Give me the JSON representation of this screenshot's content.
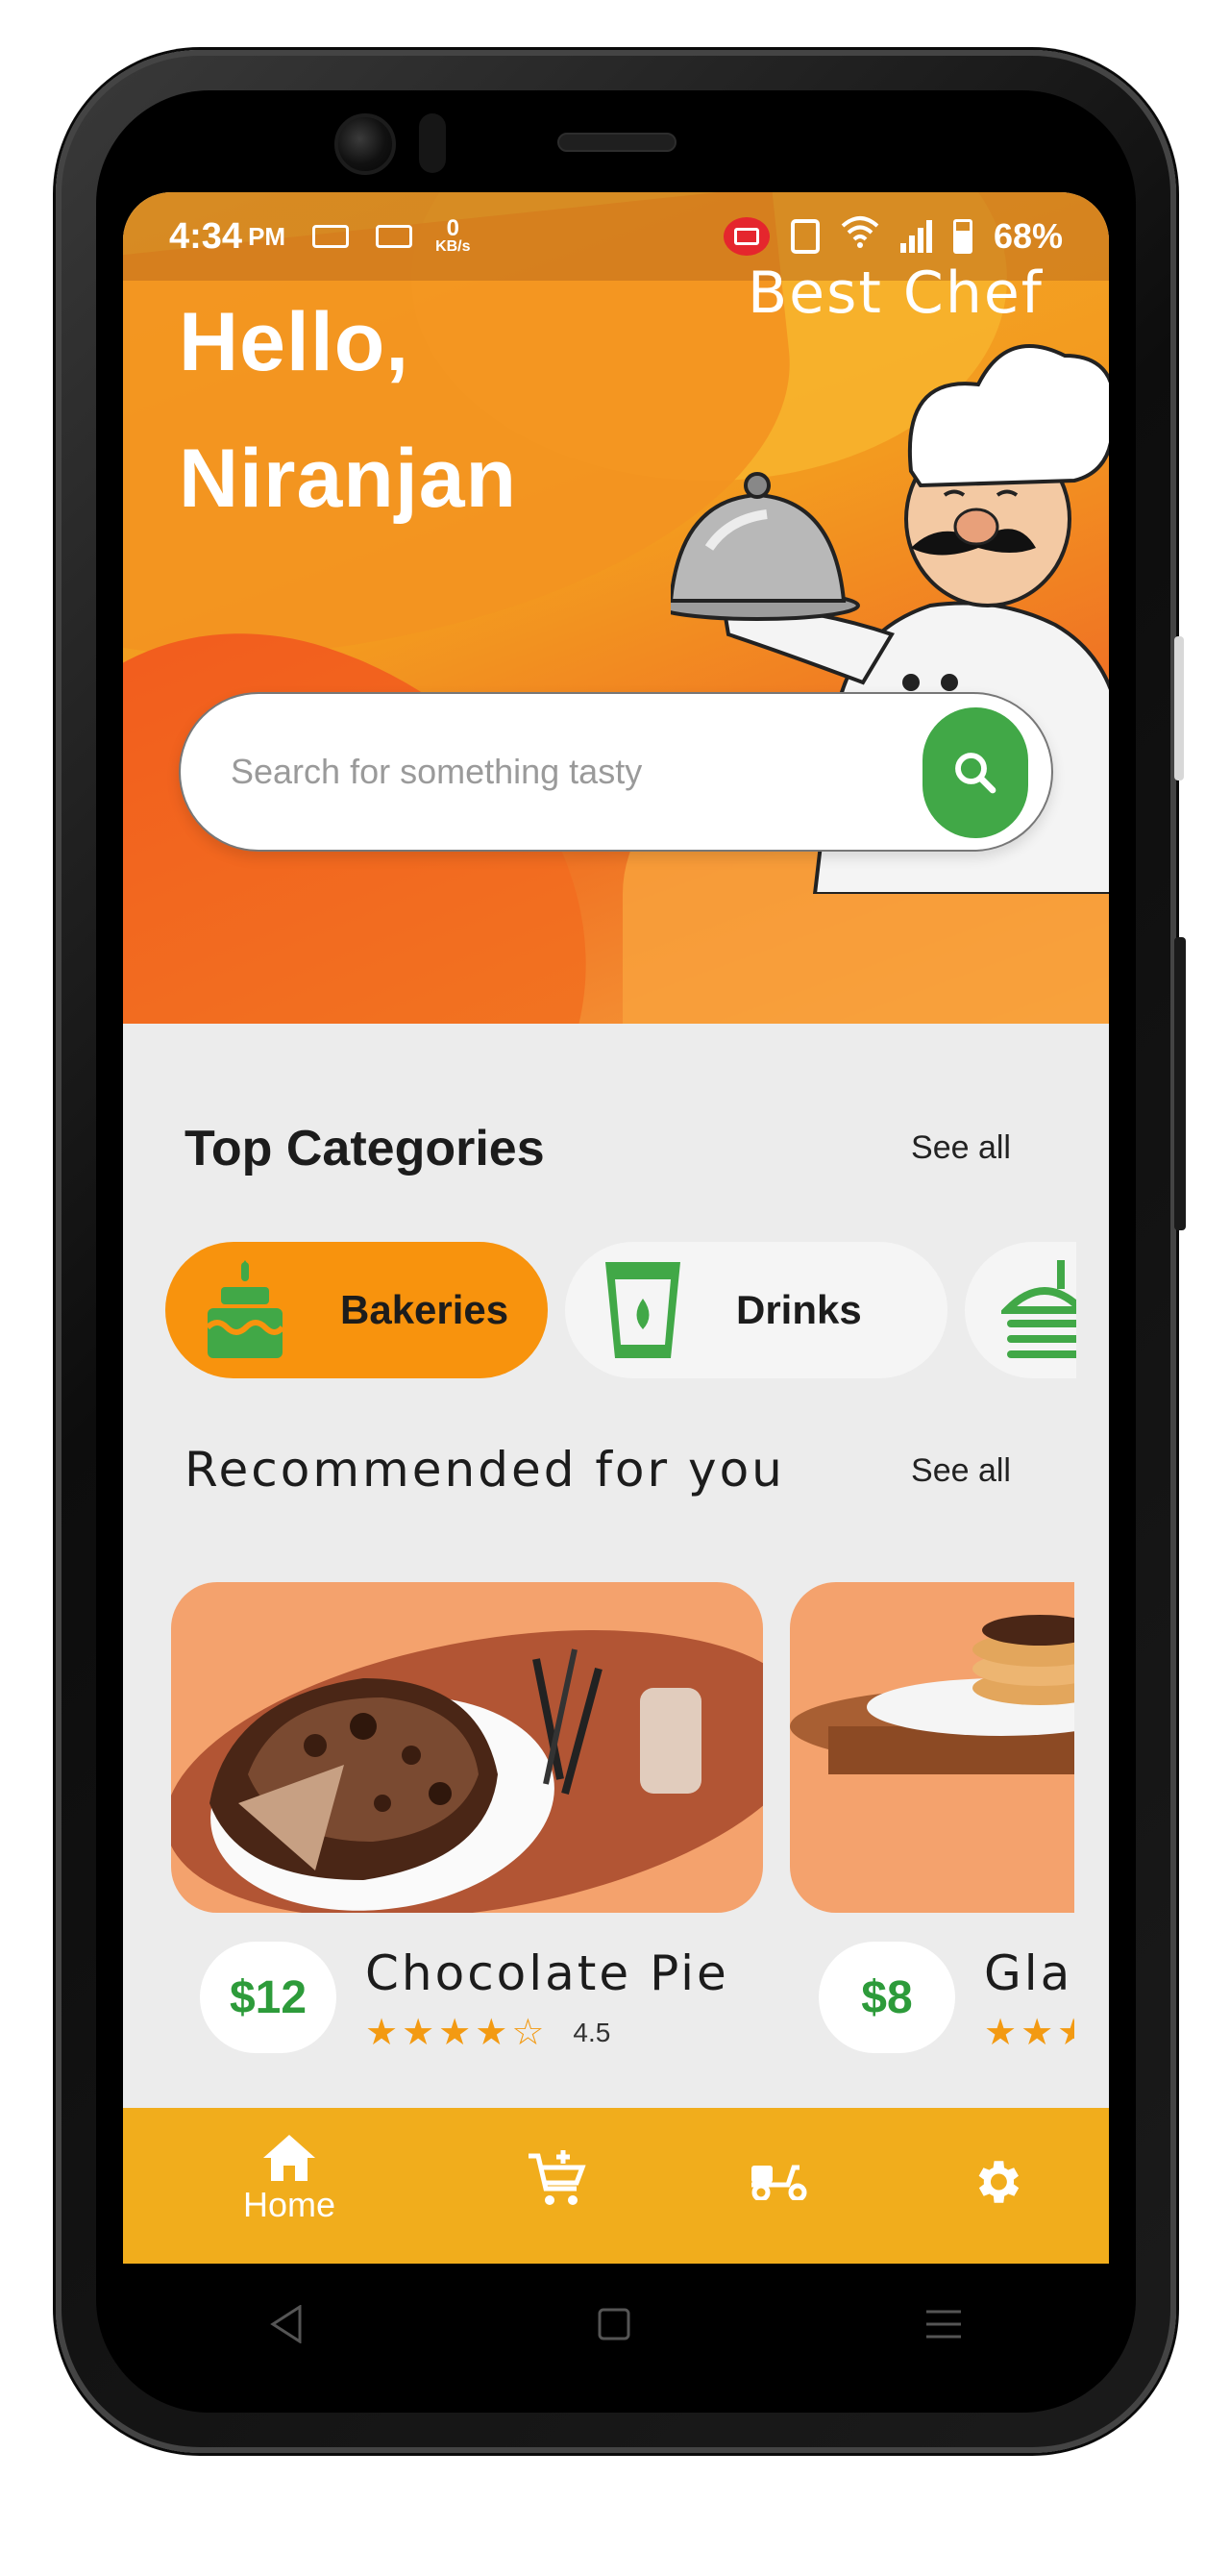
{
  "status_bar": {
    "time": "4:34",
    "ampm": "PM",
    "net_speed_value": "0",
    "net_speed_unit": "KB/s",
    "battery": "68%"
  },
  "header": {
    "greeting_line1": "Hello,",
    "greeting_line2": "Niranjan",
    "brand": "Best Chef"
  },
  "search": {
    "placeholder": "Search for something tasty"
  },
  "categories_section": {
    "title": "Top Categories",
    "see_all": "See all",
    "items": [
      {
        "label": "Bakeries",
        "icon": "cake-icon",
        "active": true
      },
      {
        "label": "Drinks",
        "icon": "drink-cup-icon",
        "active": false
      },
      {
        "label": "",
        "icon": "burger-icon",
        "active": false
      }
    ]
  },
  "recommended_section": {
    "title": "Recommended for you",
    "see_all": "See all",
    "items": [
      {
        "name": "Chocolate Pie",
        "price": "$12",
        "rating": 4.5,
        "rating_text": "4.5"
      },
      {
        "name": "Gla",
        "price": "$8",
        "rating": 3.5
      }
    ]
  },
  "bottom_nav": {
    "items": [
      {
        "label": "Home",
        "icon": "home-icon"
      },
      {
        "label": "",
        "icon": "add-to-cart-icon"
      },
      {
        "label": "",
        "icon": "delivery-scooter-icon"
      },
      {
        "label": "",
        "icon": "settings-gear-icon"
      }
    ]
  },
  "colors": {
    "accent_orange": "#f8930d",
    "nav_yellow": "#f1ad1c",
    "green": "#41a847",
    "price_green": "#2d9b3a",
    "star": "#f39a12"
  }
}
